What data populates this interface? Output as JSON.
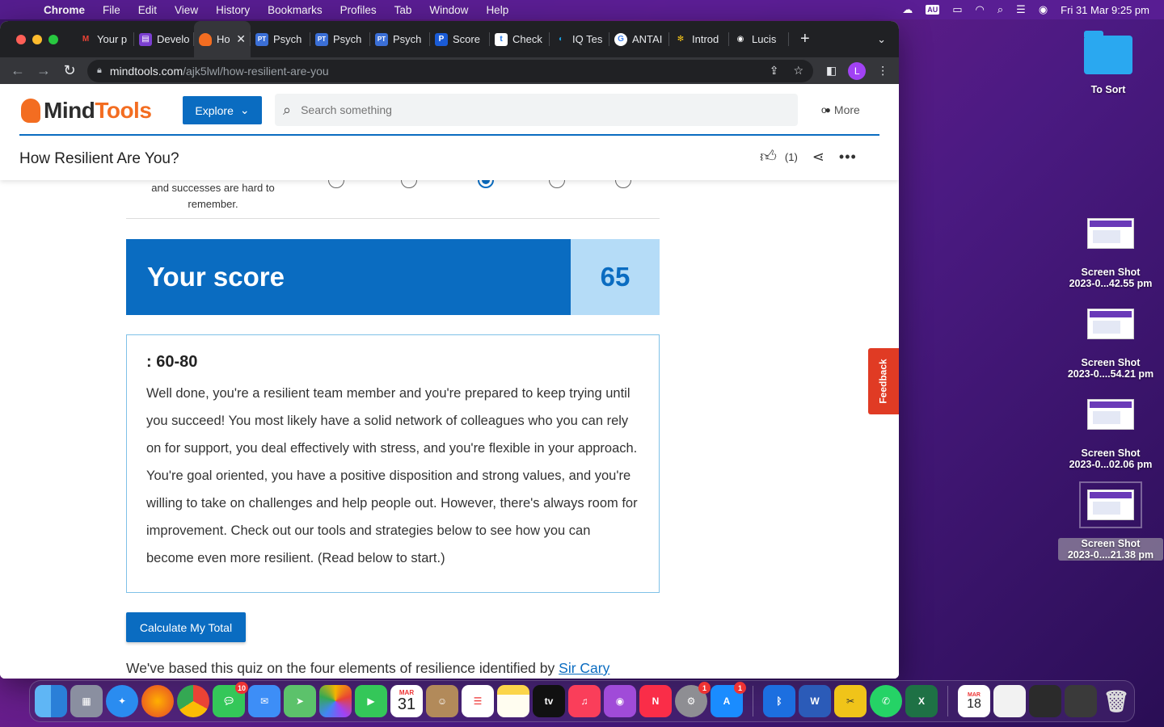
{
  "menubar": {
    "app_name": "Chrome",
    "items": [
      "File",
      "Edit",
      "View",
      "History",
      "Bookmarks",
      "Profiles",
      "Tab",
      "Window",
      "Help"
    ],
    "au_badge": "AU",
    "datetime": "Fri 31 Mar  9:25 pm"
  },
  "browser": {
    "tabs": [
      {
        "title": "Your p",
        "fav_color": "#202124",
        "fav_glyph": "M"
      },
      {
        "title": "Develo",
        "fav_color": "#7b3fd1",
        "fav_glyph": "▤"
      },
      {
        "title": "Ho",
        "fav_color": "#f36d21",
        "fav_glyph": "",
        "active": true
      },
      {
        "title": "Psych",
        "fav_color": "#3b6fd6",
        "fav_glyph": "PT"
      },
      {
        "title": "Psych",
        "fav_color": "#3b6fd6",
        "fav_glyph": "PT"
      },
      {
        "title": "Psych",
        "fav_color": "#3b6fd6",
        "fav_glyph": "PT"
      },
      {
        "title": "Score",
        "fav_color": "#1a5bd6",
        "fav_glyph": "P"
      },
      {
        "title": "Check",
        "fav_color": "#ffffff",
        "fav_glyph": "t"
      },
      {
        "title": "IQ Tes",
        "fav_color": "#1aa0e0",
        "fav_glyph": "◐"
      },
      {
        "title": "ANTAI",
        "fav_color": "#ffffff",
        "fav_glyph": "G"
      },
      {
        "title": "Introd",
        "fav_color": "#333333",
        "fav_glyph": "✻"
      },
      {
        "title": "Lucis",
        "fav_color": "#ffffff",
        "fav_glyph": "◉"
      }
    ],
    "url_host": "mindtools.com",
    "url_path": "/ajk5lwl/how-resilient-are-you",
    "profile_initial": "L"
  },
  "site": {
    "logo_mind": "Mind",
    "logo_tools": "Tools",
    "explore_label": "Explore",
    "search_placeholder": "Search something",
    "more_label": "More",
    "page_title": "How Resilient Are You?",
    "like_count": "(1)"
  },
  "quiz": {
    "partial_question": "and successes are hard to remember.",
    "selected_option": 3,
    "score_label": "Your score",
    "score_value": "65",
    "result_range": ": 60-80",
    "result_text": "Well done, you're a resilient team member and you're prepared to keep trying until you succeed! You most likely have a solid network of colleagues who you can rely on for support, you deal effectively with stress, and you're flexible in your approach. You're goal oriented, you have a positive disposition and strong values, and you're willing to take on challenges and help people out. However, there's always room for improvement. Check out our tools and strategies below to see how you can become even more resilient. (Read below to start.)",
    "calc_button": "Calculate My Total",
    "footnote_text": "We've based this quiz on the four elements of resilience identified by ",
    "footnote_link": "Sir Cary"
  },
  "feedback_label": "Feedback",
  "desktop": {
    "folder_label": "To Sort",
    "screenshots": [
      {
        "line1": "Screen Shot",
        "line2": "2023-0...42.55 pm"
      },
      {
        "line1": "Screen Shot",
        "line2": "2023-0....54.21 pm"
      },
      {
        "line1": "Screen Shot",
        "line2": "2023-0...02.06 pm"
      },
      {
        "line1": "Screen Shot",
        "line2": "2023-0....21.38 pm"
      }
    ]
  },
  "dock": {
    "messages_badge": "10",
    "calendar_month": "MAR",
    "calendar_day": "31",
    "settings_badge": "1",
    "appstore_badge": "1",
    "recent_calendar_month": "MAR",
    "recent_calendar_day": "18",
    "tv_label": "tv"
  }
}
